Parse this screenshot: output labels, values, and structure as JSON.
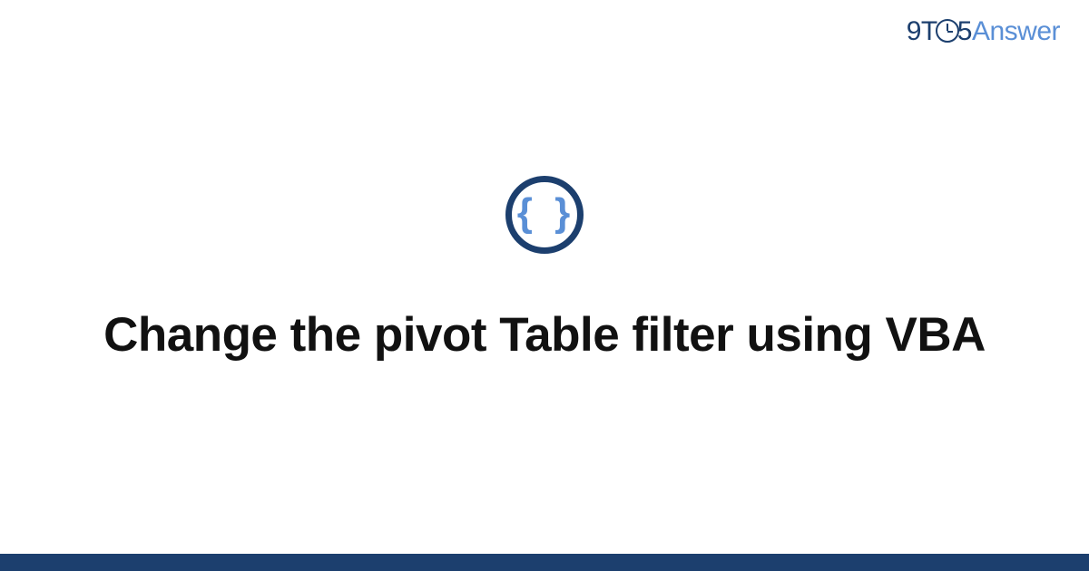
{
  "brand": {
    "part1": "9T",
    "part2": "5",
    "part3": "Answer"
  },
  "icon": {
    "glyph": "{ }"
  },
  "main": {
    "title": "Change the pivot Table filter using VBA"
  },
  "colors": {
    "dark": "#1c3f6e",
    "light": "#5a8fd6"
  }
}
